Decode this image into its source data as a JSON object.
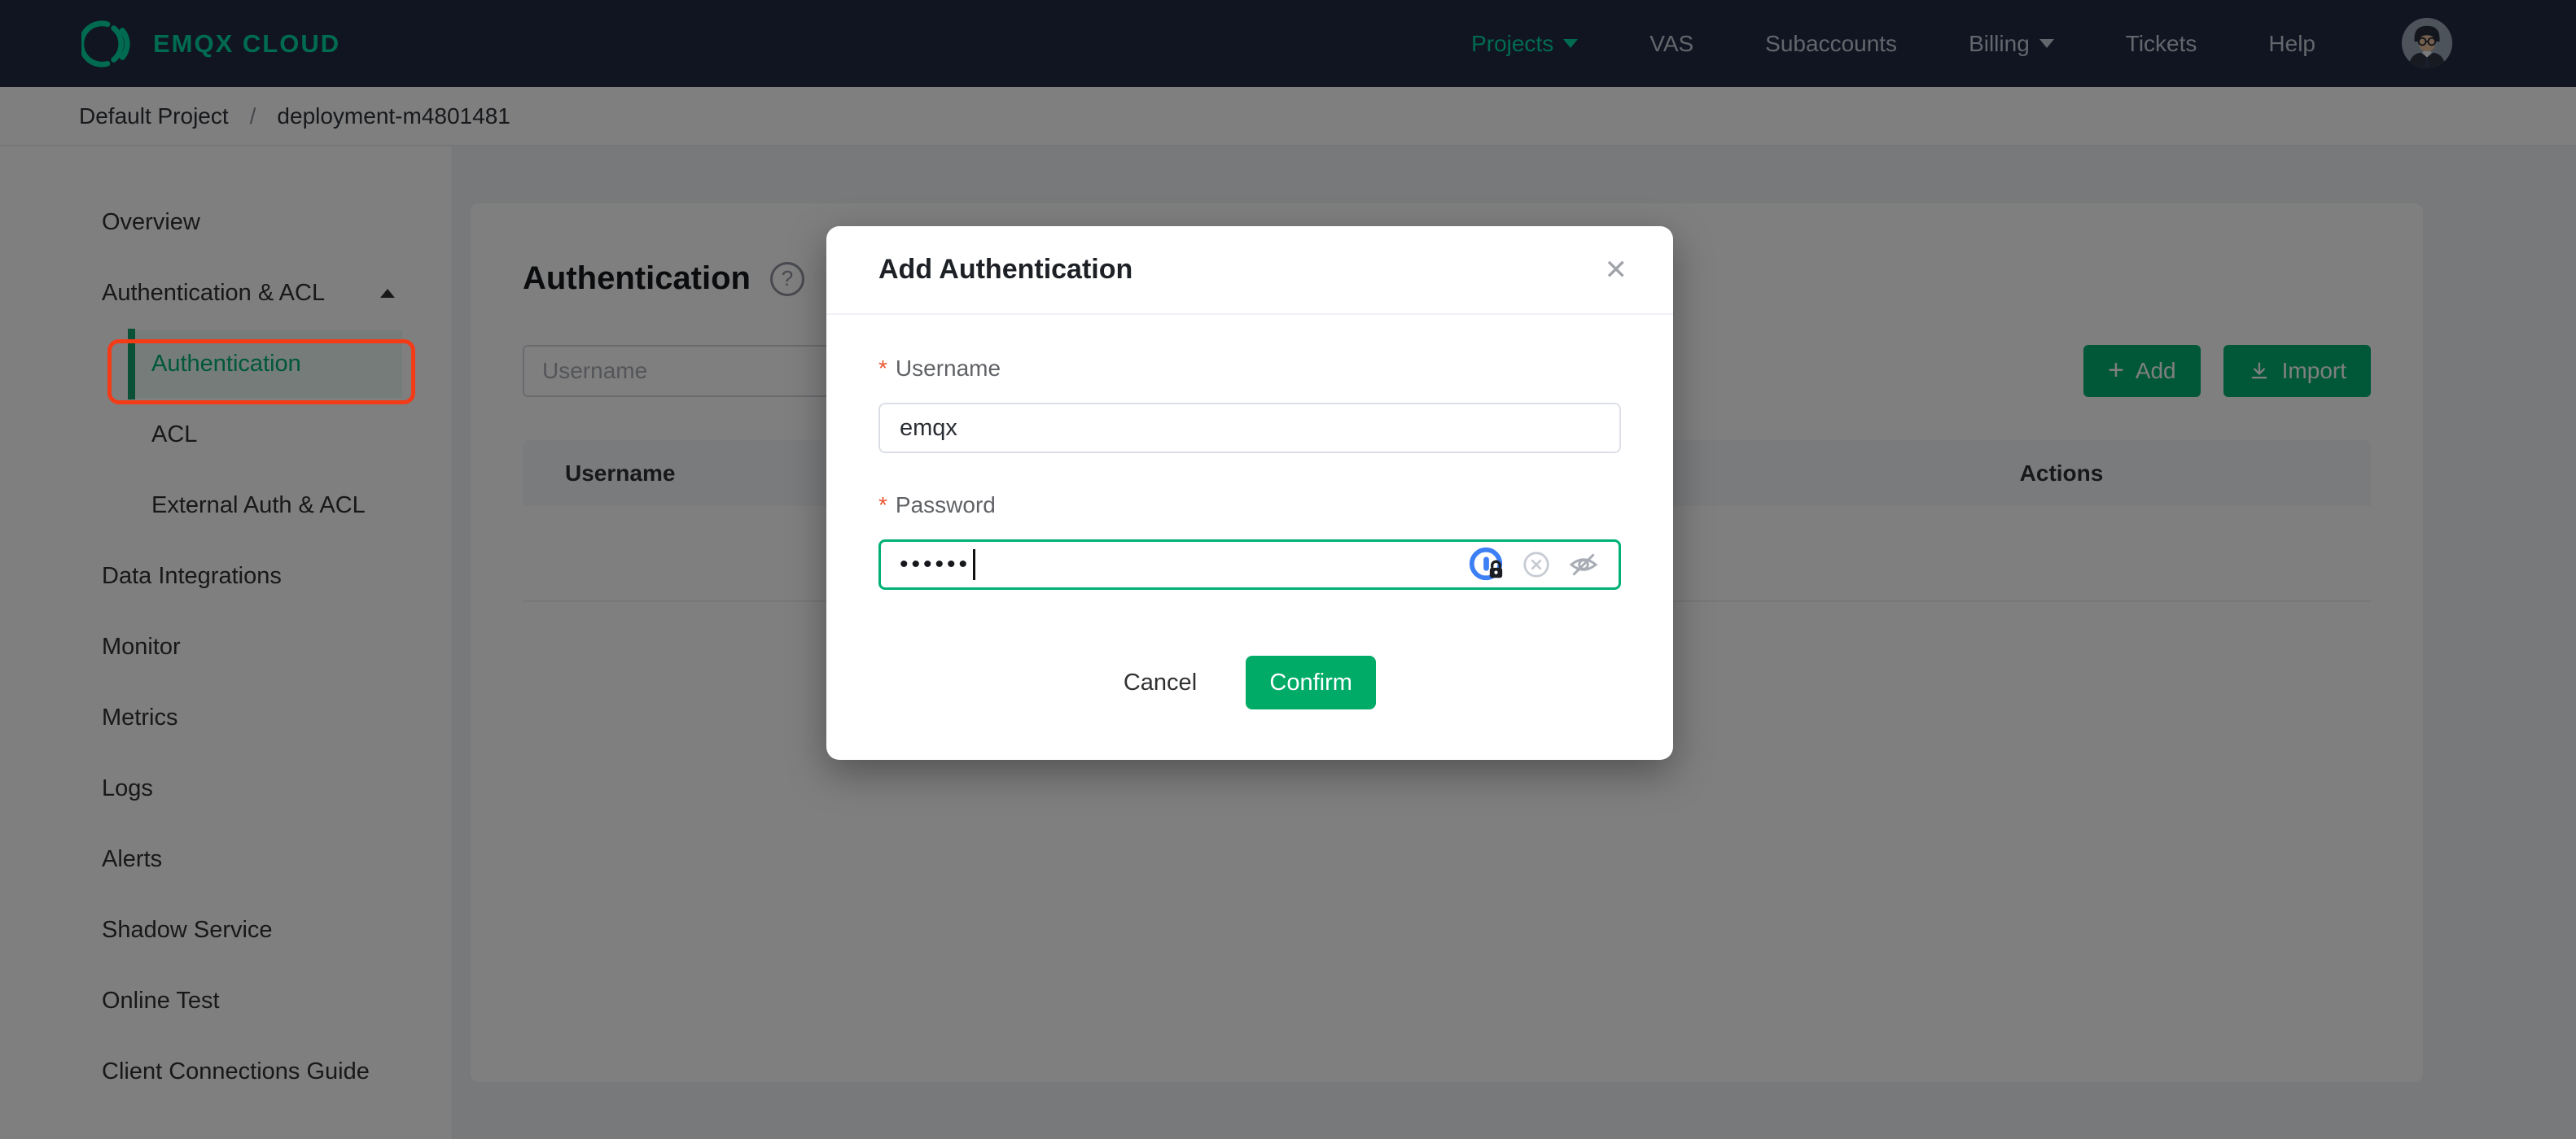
{
  "colors": {
    "accent_green": "#00b173",
    "brand_green": "#00d7a3",
    "navbar_bg": "#222a42",
    "annotation_red": "#f43b17",
    "overlay": "rgba(0,0,0,0.5)"
  },
  "navbar": {
    "brand": "EMQX CLOUD",
    "items": [
      {
        "label": "Projects",
        "dropdown": true,
        "active": true
      },
      {
        "label": "VAS"
      },
      {
        "label": "Subaccounts"
      },
      {
        "label": "Billing",
        "dropdown": true
      },
      {
        "label": "Tickets"
      },
      {
        "label": "Help"
      }
    ]
  },
  "breadcrumb": {
    "project": "Default Project",
    "separator": "/",
    "current": "deployment-m4801481"
  },
  "sidebar": {
    "items": [
      {
        "label": "Overview"
      },
      {
        "label": "Authentication & ACL",
        "expanded": true
      },
      {
        "label": "Authentication",
        "child": true,
        "active": true
      },
      {
        "label": "ACL",
        "child": true
      },
      {
        "label": "External Auth & ACL",
        "child": true
      },
      {
        "label": "Data Integrations"
      },
      {
        "label": "Monitor"
      },
      {
        "label": "Metrics"
      },
      {
        "label": "Logs"
      },
      {
        "label": "Alerts"
      },
      {
        "label": "Shadow Service"
      },
      {
        "label": "Online Test"
      },
      {
        "label": "Client Connections Guide"
      }
    ]
  },
  "main": {
    "title": "Authentication",
    "help_glyph": "?",
    "search_placeholder": "Username",
    "buttons": {
      "add_glyph": "+",
      "add": "Add",
      "import": "Import"
    },
    "table": {
      "headers": [
        "Username",
        "Actions"
      ]
    }
  },
  "modal": {
    "title": "Add Authentication",
    "close_glyph": "✕",
    "required_marker": "*",
    "fields": [
      {
        "label": "Username",
        "value": "emqx"
      },
      {
        "label": "Password",
        "value": "••••••",
        "masked": true
      }
    ],
    "buttons": {
      "cancel": "Cancel",
      "confirm": "Confirm"
    }
  }
}
